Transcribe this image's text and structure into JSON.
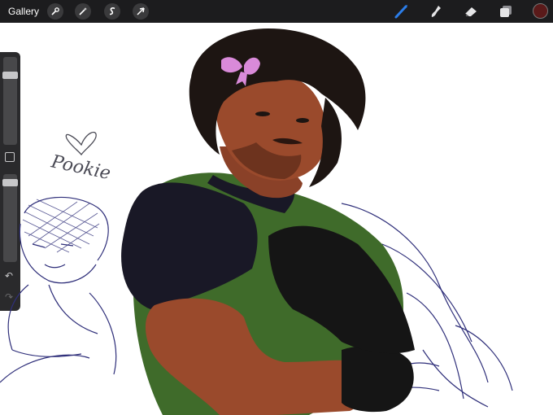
{
  "toolbar": {
    "gallery_label": "Gallery",
    "left_tools": [
      "wrench-icon",
      "magic-wand-icon",
      "selection-s-icon",
      "transform-arrow-icon"
    ],
    "right_tools": [
      "brush-icon",
      "smudge-icon",
      "eraser-icon",
      "layers-icon"
    ],
    "active_tool": "brush-icon",
    "active_tool_color": "#2b7de9",
    "current_color": "#5a1a1a"
  },
  "sidebar": {
    "brush_size_level": 0.18,
    "opacity_level": 0.06
  },
  "canvas": {
    "handwritten_text": "Pookie",
    "colors": {
      "hair": "#1d1512",
      "skin": "#9a4a2c",
      "shirt": "#191826",
      "vest": "#3f6b2a",
      "bow": "#d98ad9",
      "sketch": "#2f2f7a"
    }
  }
}
